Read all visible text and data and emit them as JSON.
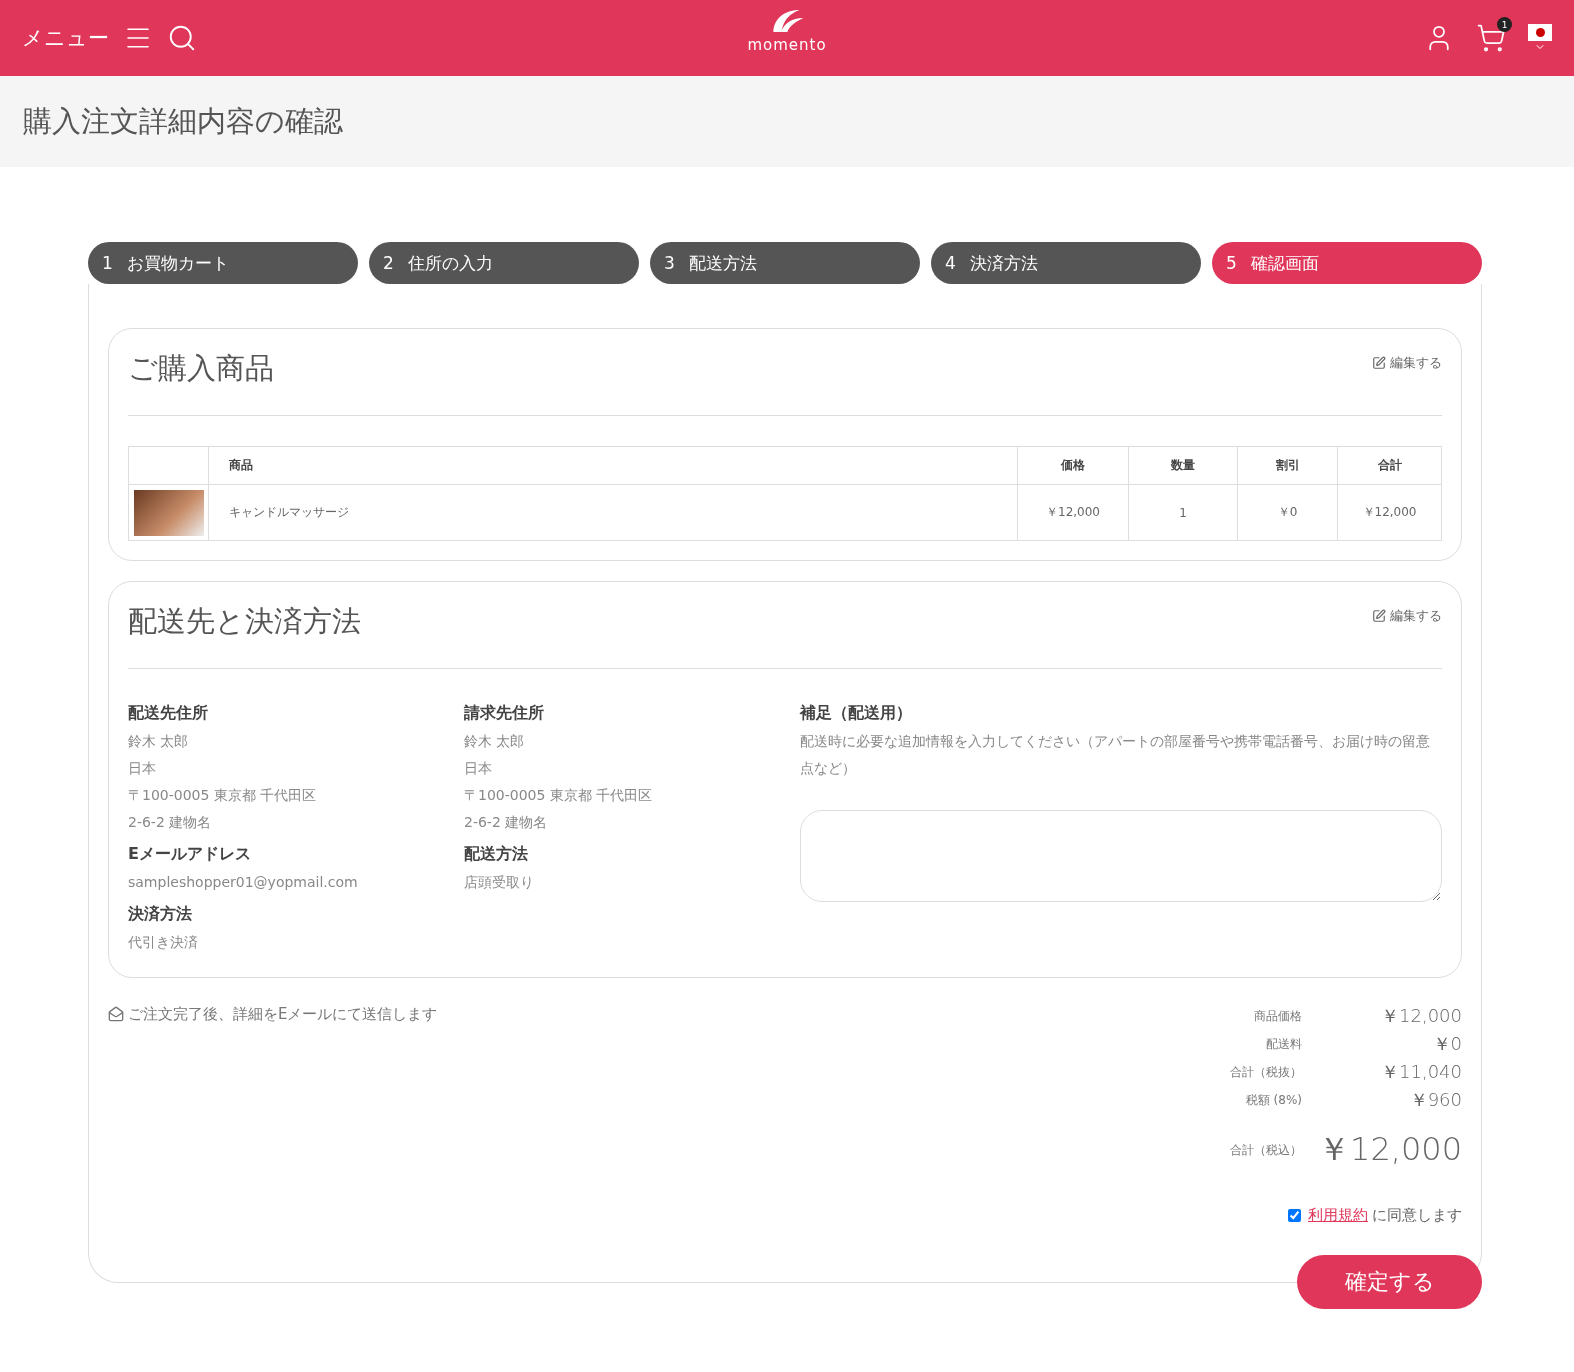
{
  "header": {
    "menu_label": "メニュー",
    "logo_text": "momento",
    "cart_count": "1"
  },
  "page_title": "購入注文詳細内容の確認",
  "steps": [
    {
      "number": "1",
      "label": "お買物カート",
      "selected": false
    },
    {
      "number": "2",
      "label": "住所の入力",
      "selected": false
    },
    {
      "number": "3",
      "label": "配送方法",
      "selected": false
    },
    {
      "number": "4",
      "label": "決済方法",
      "selected": false
    },
    {
      "number": "5",
      "label": "確認画面",
      "selected": true
    }
  ],
  "products": {
    "title": "ご購入商品",
    "edit_link": "編集する",
    "columns": [
      "商品",
      "価格",
      "数量",
      "割引",
      "合計"
    ],
    "rows": [
      {
        "name": "キャンドルマッサージ",
        "price": "￥12,000",
        "quantity": "1",
        "discount": "￥0",
        "total": "￥12,000"
      }
    ]
  },
  "delivery": {
    "title": "配送先と決済方法",
    "edit_link": "編集する",
    "columns": [
      [
        {
          "heading": "配送先住所",
          "lines": [
            "鈴木 太郎",
            "日本",
            "〒100-0005 東京都 千代田区",
            "2-6-2 建物名"
          ]
        },
        {
          "heading": "Eメールアドレス",
          "lines": [
            "sampleshopper01@yopmail.com"
          ]
        },
        {
          "heading": "決済方法",
          "lines": [
            "代引き決済"
          ]
        }
      ],
      [
        {
          "heading": "請求先住所",
          "lines": [
            "鈴木 太郎",
            "日本",
            "〒100-0005 東京都 千代田区",
            "2-6-2 建物名"
          ]
        },
        {
          "heading": "配送方法",
          "lines": [
            "店頭受取り"
          ]
        }
      ]
    ],
    "note": {
      "heading": "補足（配送用）",
      "description": "配送時に必要な追加情報を入力してください（アパートの部屋番号や携帯電話番号、お届け時の留意点など）"
    }
  },
  "email_notice": "ご注文完了後、詳細をEメールにて送信します",
  "totals": [
    {
      "label": "商品価格",
      "value": "￥12,000",
      "kind": "normal"
    },
    {
      "label": "配送料",
      "value": "￥0",
      "kind": "normal"
    },
    {
      "label": "合計（税抜）",
      "value": "￥11,040",
      "kind": "normal"
    },
    {
      "label": "税額 (8%)",
      "value": "￥960",
      "kind": "normal"
    },
    {
      "label": "合計（税込）",
      "value": "￥12,000",
      "kind": "grand"
    }
  ],
  "terms": {
    "checked": true,
    "link": "利用規約",
    "text": "に同意します"
  },
  "confirm_button": "確定する"
}
